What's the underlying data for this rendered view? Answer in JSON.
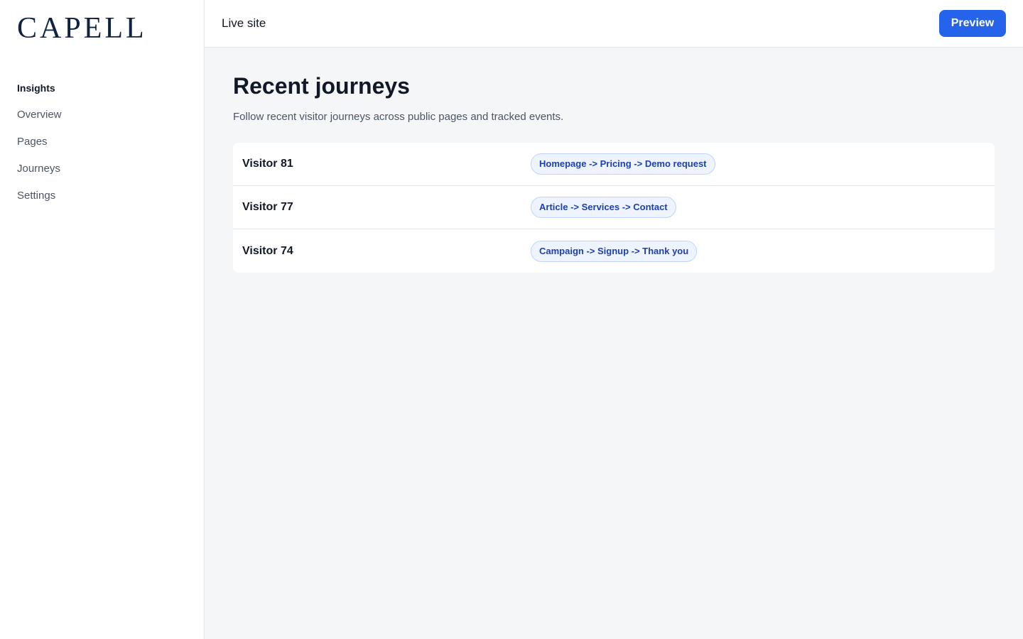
{
  "brand": {
    "logo_text": "CAPELL"
  },
  "sidebar": {
    "section_label": "Insights",
    "items": [
      {
        "label": "Overview"
      },
      {
        "label": "Pages"
      },
      {
        "label": "Journeys"
      },
      {
        "label": "Settings"
      }
    ]
  },
  "topbar": {
    "site_label": "Live site",
    "preview_label": "Preview"
  },
  "main": {
    "title": "Recent journeys",
    "subtitle": "Follow recent visitor journeys across public pages and tracked events.",
    "journeys": [
      {
        "visitor": "Visitor 81",
        "path": "Homepage -> Pricing -> Demo request"
      },
      {
        "visitor": "Visitor 77",
        "path": "Article -> Services -> Contact"
      },
      {
        "visitor": "Visitor 74",
        "path": "Campaign -> Signup -> Thank you"
      }
    ]
  },
  "colors": {
    "accent": "#2563eb",
    "badge_bg": "#eef4ff",
    "badge_text": "#1e40af",
    "logo": "#0f2340"
  }
}
